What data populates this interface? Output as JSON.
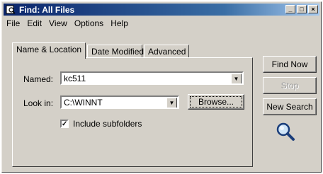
{
  "window": {
    "title": "Find: All Files",
    "controls": {
      "minimize": "_",
      "maximize": "□",
      "close": "×"
    }
  },
  "menu": [
    {
      "label": "File"
    },
    {
      "label": "Edit"
    },
    {
      "label": "View"
    },
    {
      "label": "Options"
    },
    {
      "label": "Help"
    }
  ],
  "tabs": [
    {
      "label": "Name & Location",
      "active": true
    },
    {
      "label": "Date Modified",
      "active": false
    },
    {
      "label": "Advanced",
      "active": false
    }
  ],
  "form": {
    "named_label": "Named:",
    "named_value": "kc511",
    "lookin_label": "Look in:",
    "lookin_value": "C:\\WINNT",
    "browse_label": "Browse...",
    "include_subfolders_label": "Include subfolders",
    "include_subfolders_checked": true,
    "checkmark": "✓",
    "dropdown_arrow": "▼"
  },
  "buttons": {
    "find_now": "Find Now",
    "stop": "Stop",
    "new_search": "New Search"
  },
  "icons": {
    "app": "find-files-icon",
    "search": "magnifier-icon"
  }
}
